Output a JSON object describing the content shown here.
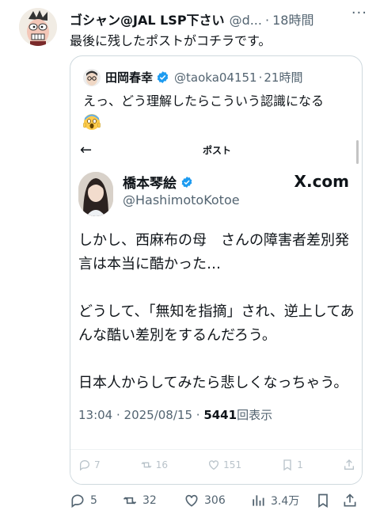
{
  "post": {
    "display_name": "ゴシャン@JAL LSP下さい",
    "handle": "@d...",
    "time": "18時間",
    "more_icon": "more-dots-icon",
    "text": "最後に残したポストがコチラです。"
  },
  "quote": {
    "display_name": "田岡春幸",
    "handle": "@taoka04151",
    "time": "21時間",
    "text": "えっ、どう理解したらこういう認識になる",
    "emoji": "scream-emoji"
  },
  "embedded": {
    "nav_title": "ポスト",
    "display_name": "橋本琴絵",
    "handle": "@HashimotoKotoe",
    "brand": "X.com",
    "paragraphs": [
      "しかし、西麻布の母　さんの障害者差別発言は本当に酷かった…",
      "どうして、「無知を指摘」され、逆上してあんな酷い差別をするんだろう。",
      "日本人からしてみたら悲しくなっちゃう。"
    ],
    "timestamp": "13:04 · 2025/08/15 ·",
    "views_count": "5441",
    "views_label": "回表示",
    "actions": {
      "reply": "7",
      "retweet": "16",
      "like": "151",
      "bookmark": "1"
    }
  },
  "actions": {
    "reply": "5",
    "retweet": "32",
    "like": "306",
    "views": "3.4万"
  },
  "colors": {
    "text": "#0f1419",
    "secondary": "#536471",
    "verified": "#1d9bf0",
    "border": "#cfd9de"
  }
}
